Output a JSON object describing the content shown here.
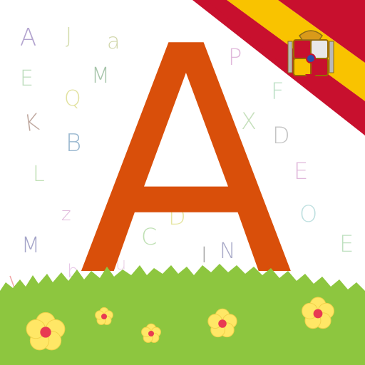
{
  "main_letter": {
    "text": "A",
    "color": "#d94f0a"
  },
  "background_letters": [
    {
      "text": "A",
      "color": "#b3a4cf"
    },
    {
      "text": "J",
      "color": "#d2dba9"
    },
    {
      "text": "a",
      "color": "#d2d7ac"
    },
    {
      "text": "E",
      "color": "#bcdcbc"
    },
    {
      "text": "M",
      "color": "#a7c5ab"
    },
    {
      "text": "Q",
      "color": "#e2e2a0"
    },
    {
      "text": "K",
      "color": "#bfa89f"
    },
    {
      "text": "B",
      "color": "#9ab8d0"
    },
    {
      "text": "L",
      "color": "#bfe0b4"
    },
    {
      "text": "z",
      "color": "#e0b8db"
    },
    {
      "text": "M",
      "color": "#a4a4c8"
    },
    {
      "text": "I",
      "color": "#f0a6a6"
    },
    {
      "text": "b",
      "color": "#e8c8e8"
    },
    {
      "text": "u",
      "color": "#ead0e6"
    },
    {
      "text": "C",
      "color": "#bfe0b4"
    },
    {
      "text": "D",
      "color": "#e6e6a4"
    },
    {
      "text": "I",
      "color": "#a6a6a6"
    },
    {
      "text": "N",
      "color": "#a9aac8"
    },
    {
      "text": "P",
      "color": "#e0b8db"
    },
    {
      "text": "F",
      "color": "#bde0c6"
    },
    {
      "text": "X",
      "color": "#c6e0bc"
    },
    {
      "text": "D",
      "color": "#c4c4c4"
    },
    {
      "text": "E",
      "color": "#e0b8db"
    },
    {
      "text": "O",
      "color": "#bfe0e0"
    },
    {
      "text": "E",
      "color": "#bfe0c0"
    }
  ],
  "flag": {
    "red": "#c8102e",
    "yellow": "#f9c300",
    "icon": "spain-flag-ribbon"
  },
  "grass": {
    "color": "#8dc63f",
    "dark": "#77b02f"
  },
  "flowers": {
    "petal": "#ffe766",
    "center": "#e83a52",
    "icon": "flower-icon"
  }
}
